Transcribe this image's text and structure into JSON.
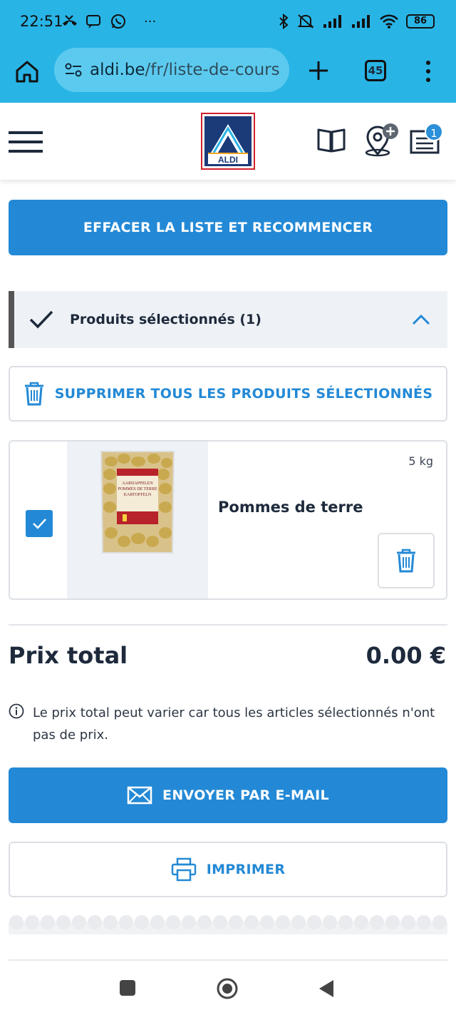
{
  "status_bar": {
    "time": "22:51",
    "notif_more": "···",
    "battery": "86"
  },
  "browser": {
    "url_domain": "aldi.be",
    "url_path": "/fr/liste-de-cours",
    "tab_count": "45"
  },
  "header": {
    "logo_text": "ALDI",
    "list_badge": "1"
  },
  "actions": {
    "clear_list_label": "EFFACER LA LISTE ET RECOMMENCER",
    "delete_all_label": "SUPPRIMER TOUS LES PRODUITS SÉLECTIONNÉS",
    "email_label": "ENVOYER PAR E-MAIL",
    "print_label": "IMPRIMER"
  },
  "section": {
    "title": "Produits sélectionnés (1)"
  },
  "products": [
    {
      "name": "Pommes de terre",
      "weight": "5 kg",
      "checked": true,
      "package_text": "AARDAPPELEN POMMES DE TERRE KARTOFFELN"
    }
  ],
  "total": {
    "label": "Prix total",
    "value": "0.00 €"
  },
  "info": {
    "text": "Le prix total peut varier car tous les articles sélectionnés n'ont pas de prix."
  },
  "colors": {
    "brand_blue": "#2389d6",
    "browser_bar": "#29b4e6",
    "section_bg": "#eef2f6",
    "text_dark": "#1e2a3c"
  }
}
